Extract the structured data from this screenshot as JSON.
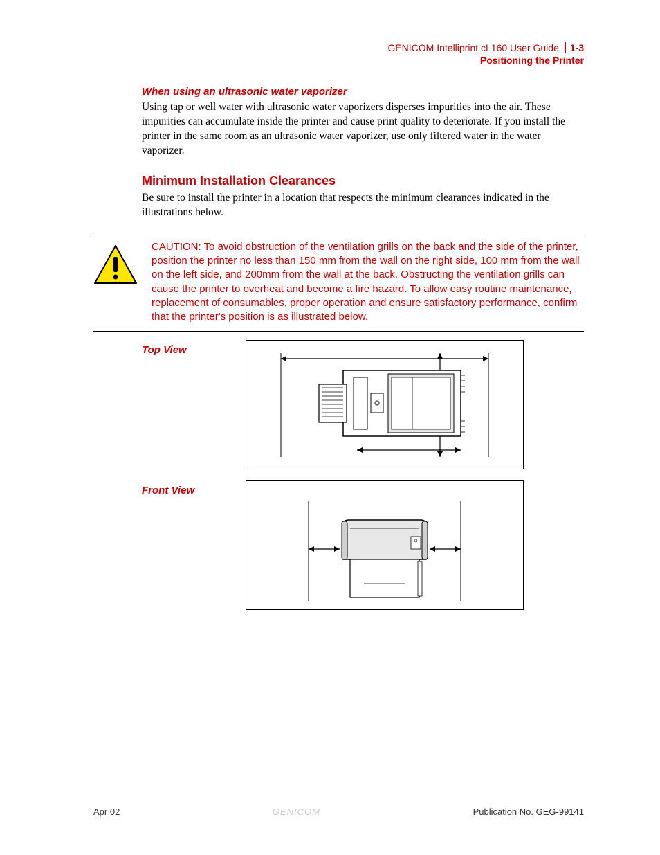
{
  "header": {
    "doc_title": "GENICOM Intelliprint cL160 User Guide",
    "page_num": "1-3",
    "section": "Positioning the Printer"
  },
  "vaporizer": {
    "heading": "When using an ultrasonic water vaporizer",
    "body": "Using tap or well water with ultrasonic water vaporizers disperses impurities into the air. These impurities can accumulate inside the printer and cause print quality to deteriorate. If you install the printer in the same room as an ultrasonic water vaporizer, use only filtered water in the water vaporizer."
  },
  "clearances": {
    "heading": "Minimum Installation Clearances",
    "body": "Be sure to install the printer in a location that respects the minimum clearances indicated in the illustrations below."
  },
  "caution": {
    "text": "CAUTION: To avoid obstruction of the ventilation grills on the back and the side of the printer, position the printer no less than 150 mm from the wall on the right side, 100 mm from the wall on the left side, and 200mm from the wall at the back. Obstructing the ventilation grills can cause the printer to overheat and become a fire hazard. To allow easy routine maintenance, replacement of consumables, proper operation and ensure satisfactory performance, confirm that the printer's position is as illustrated below."
  },
  "views": {
    "top": "Top View",
    "front": "Front View"
  },
  "footer": {
    "date": "Apr 02",
    "brand": "GENICOM",
    "pub": "Publication No. GEG-99141"
  }
}
